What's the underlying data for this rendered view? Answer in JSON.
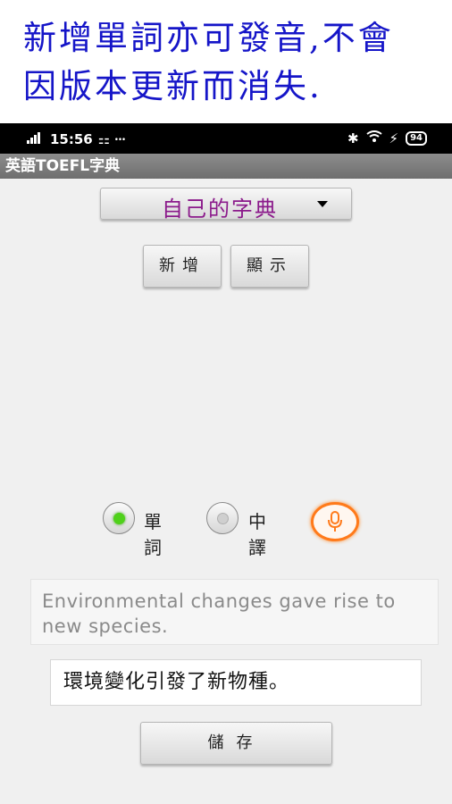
{
  "banner": {
    "line1": "新增單詞亦可發音,不會",
    "line2": "因版本更新而消失."
  },
  "statusbar": {
    "time": "15:56",
    "extra_icons": "⚏ ⸱⸱⸱",
    "battery": "94"
  },
  "app": {
    "title": "英語TOEFL字典"
  },
  "dictionary_select": {
    "selected": "自己的字典"
  },
  "buttons": {
    "add": "新增",
    "show": "顯示",
    "save": "儲存"
  },
  "mode": {
    "options": [
      {
        "label": "單詞",
        "checked": true
      },
      {
        "label": "中譯",
        "checked": false
      }
    ]
  },
  "entry": {
    "word": "Environmental changes gave rise to new species.",
    "translation": "環境變化引發了新物種。"
  },
  "colors": {
    "banner_text": "#1515c8",
    "dictionary_text": "#8b1a8b",
    "mic_accent": "#ff7a1a",
    "radio_checked": "#4fd11a"
  }
}
